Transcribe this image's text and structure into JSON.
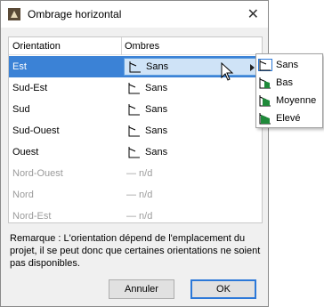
{
  "window": {
    "title": "Ombrage horizontal"
  },
  "table": {
    "headers": [
      "Orientation",
      "Ombres"
    ],
    "rows": [
      {
        "orientation": "Est",
        "ombres": "Sans"
      },
      {
        "orientation": "Sud-Est",
        "ombres": "Sans"
      },
      {
        "orientation": "Sud",
        "ombres": "Sans"
      },
      {
        "orientation": "Sud-Ouest",
        "ombres": "Sans"
      },
      {
        "orientation": "Ouest",
        "ombres": "Sans"
      },
      {
        "orientation": "Nord-Ouest",
        "ombres": "— n/d"
      },
      {
        "orientation": "Nord",
        "ombres": "— n/d"
      },
      {
        "orientation": "Nord-Est",
        "ombres": "— n/d"
      }
    ]
  },
  "remark": "Remarque : L'orientation dépend de l'emplacement du projet, il se peut donc que certaines orientations ne soient pas disponibles.",
  "buttons": {
    "cancel": "Annuler",
    "ok": "OK"
  },
  "submenu": {
    "items": [
      "Sans",
      "Bas",
      "Moyenne",
      "Elevé"
    ]
  },
  "colors": {
    "accent": "#3b82d6",
    "shade_green": "#1f8a3a"
  }
}
